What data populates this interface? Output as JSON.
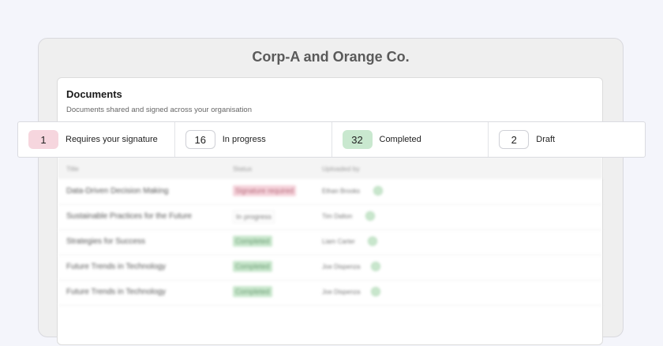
{
  "app_title": "Corp-A and Orange Co.",
  "card": {
    "heading": "Documents",
    "subtitle": "Documents shared and signed across your organisation"
  },
  "stats": [
    {
      "count": "1",
      "label": "Requires your signature",
      "color": "#f6d6de"
    },
    {
      "count": "16",
      "label": "In progress",
      "color": "#ffffff"
    },
    {
      "count": "32",
      "label": "Completed",
      "color": "#c9e8cf"
    },
    {
      "count": "2",
      "label": "Draft",
      "color": "#ffffff"
    }
  ],
  "table": {
    "columns": [
      "Title",
      "Status",
      "Uploaded by"
    ],
    "rows": [
      {
        "title": "Data-Driven Decision Making",
        "status": "Signature required",
        "uploader": "Ethan Brooks"
      },
      {
        "title": "Sustainable Practices for the Future",
        "status": "In progress",
        "uploader": "Tim Dalton"
      },
      {
        "title": "Strategies for Success",
        "status": "Completed",
        "uploader": "Liam Carter"
      },
      {
        "title": "Future Trends in Technology",
        "status": "Completed",
        "uploader": "Joe Dispenza"
      },
      {
        "title": "Future Trends in Technology",
        "status": "Completed",
        "uploader": "Joe Dispenza"
      }
    ]
  }
}
